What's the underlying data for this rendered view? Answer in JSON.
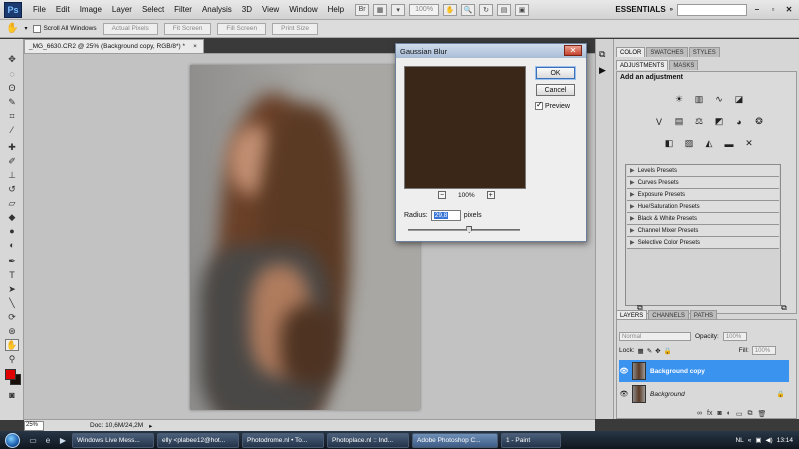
{
  "app": {
    "logo": "Ps"
  },
  "menubar": {
    "items": [
      "File",
      "Edit",
      "Image",
      "Layer",
      "Select",
      "Filter",
      "Analysis",
      "3D",
      "View",
      "Window",
      "Help"
    ],
    "zoom": "100%",
    "workspace": "ESSENTIALS",
    "window_buttons": [
      "–",
      "▫",
      "✕"
    ]
  },
  "options_bar": {
    "scroll_all_label": "Scroll All Windows",
    "actual_pixels": "Actual Pixels",
    "fit_screen": "Fit Screen",
    "fill_screen": "Fill Screen",
    "print_size": "Print Size"
  },
  "document": {
    "tab_title": "_MG_6630.CR2 @ 25% (Background copy, RGB/8*) *",
    "tab_close": "×",
    "status_zoom": "25%",
    "status_doc": "Doc: 10,6M/24,2M"
  },
  "dialog": {
    "title": "Gaussian Blur",
    "close": "✕",
    "ok": "OK",
    "cancel": "Cancel",
    "preview_label": "Preview",
    "zoom_minus": "−",
    "zoom_value": "100%",
    "zoom_plus": "+",
    "radius_label": "Radius:",
    "radius_value": "29,8",
    "radius_unit": "pixels",
    "slider_fraction": 0.55
  },
  "panels": {
    "top_tabs": [
      "COLOR",
      "SWATCHES",
      "STYLES"
    ],
    "adj_tabs": [
      "ADJUSTMENTS",
      "MASKS"
    ],
    "adj_title": "Add an adjustment",
    "presets": [
      "Levels Presets",
      "Curves Presets",
      "Exposure Presets",
      "Hue/Saturation Presets",
      "Black & White Presets",
      "Channel Mixer Presets",
      "Selective Color Presets"
    ],
    "layer_tabs": [
      "LAYERS",
      "CHANNELS",
      "PATHS"
    ],
    "blend_mode": "Normal",
    "opacity_label": "Opacity:",
    "opacity_value": "100%",
    "lock_label": "Lock:",
    "fill_label": "Fill:",
    "fill_value": "100%",
    "layers": [
      {
        "name": "Background copy",
        "selected": true
      },
      {
        "name": "Background",
        "selected": false
      }
    ]
  },
  "taskbar": {
    "tasks": [
      "Windows Live Mess...",
      "elly <plabee12@hot...",
      "Photodrome.nl • To...",
      "Photoplace.nl :: Ind...",
      "Adobe Photoshop C...",
      "1 - Paint"
    ],
    "active_task": 4,
    "lang": "NL",
    "time": "13:14"
  },
  "colors": {
    "foreground": "#e00000",
    "background": "#1a0f08",
    "layer_selected": "#3b93f0",
    "preview": "#3b2717"
  }
}
